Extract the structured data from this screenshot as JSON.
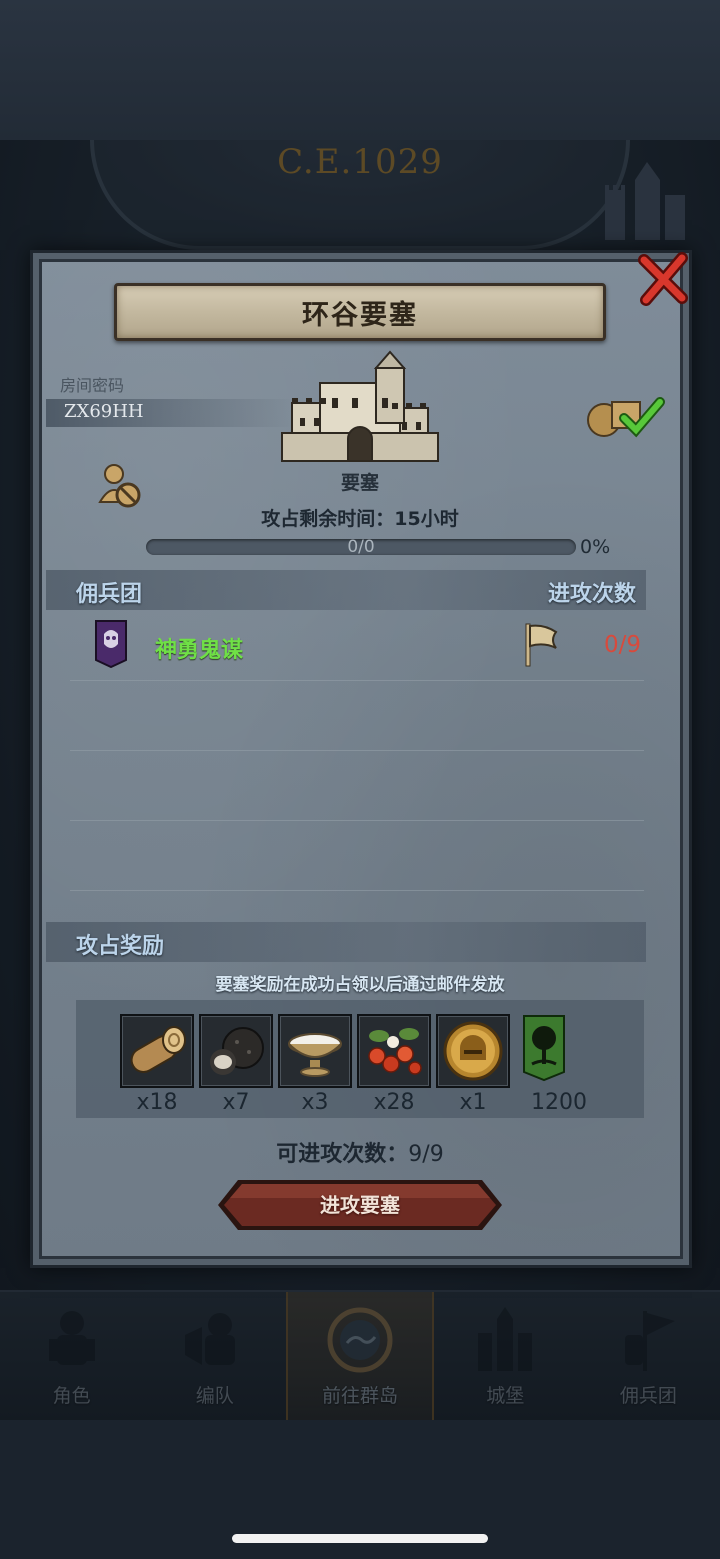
{
  "background": {
    "era": "C.E.1029"
  },
  "modal": {
    "title": "环谷要塞",
    "room_label": "房间密码",
    "room_code": "ZX69HH",
    "fortress_label": "要塞",
    "time_label": "攻占剩余时间：15小时",
    "progress_text": "0/0",
    "progress_percent": "0%",
    "progress_value": 0,
    "mercenary_header": "佣兵团",
    "attack_header": "进攻次数",
    "guilds": [
      {
        "name": "神勇鬼谋",
        "attacks": "0/9"
      }
    ],
    "rewards_header": "攻占奖励",
    "rewards_note": "要塞奖励在成功占领以后通过邮件发放",
    "rewards": [
      {
        "icon": "wood-log-icon",
        "count": "x18"
      },
      {
        "icon": "truffle-icon",
        "count": "x7"
      },
      {
        "icon": "milk-bowl-icon",
        "count": "x3"
      },
      {
        "icon": "berries-icon",
        "count": "x28"
      },
      {
        "icon": "helmet-medal-icon",
        "count": "x1"
      },
      {
        "icon": "guild-banner-icon",
        "count": "1200"
      }
    ],
    "attempts_label": "可进攻次数：",
    "attempts_value": "9/9",
    "attack_button": "进攻要塞",
    "colors": {
      "guild_name": "#6fe046",
      "attack_count": "#d84a3c",
      "section_title": "#bcd4ea",
      "button": "#6b2a22"
    }
  },
  "nav": {
    "items": [
      {
        "label": "角色",
        "icon": "knight-icon"
      },
      {
        "label": "编队",
        "icon": "formation-icon"
      },
      {
        "label": "前往群岛",
        "icon": "island-compass-icon"
      },
      {
        "label": "城堡",
        "icon": "castle-icon"
      },
      {
        "label": "佣兵团",
        "icon": "mercenary-icon"
      }
    ]
  }
}
